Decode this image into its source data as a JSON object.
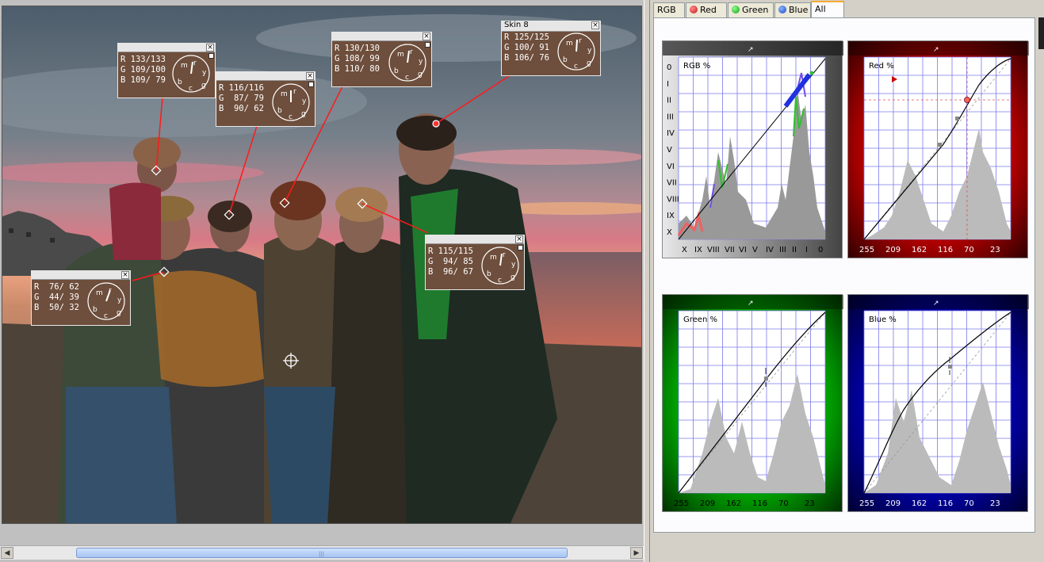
{
  "samples": [
    {
      "id": "s1",
      "title": "",
      "r": "R 133/133",
      "g": "G 109/100",
      "b": "B 109/ 79"
    },
    {
      "id": "s2",
      "title": "",
      "r": "R 116/116",
      "g": "G  87/ 79",
      "b": "B  90/ 62"
    },
    {
      "id": "s3",
      "title": "",
      "r": "R 130/130",
      "g": "G 108/ 99",
      "b": "B 110/ 80"
    },
    {
      "id": "s4",
      "title": "Skin 8",
      "r": "R 125/125",
      "g": "G 100/ 91",
      "b": "B 106/ 76"
    },
    {
      "id": "s5",
      "title": "",
      "r": "R 115/115",
      "g": "G  94/ 85",
      "b": "B  96/ 67"
    },
    {
      "id": "s6",
      "title": "",
      "r": "R  76/ 62",
      "g": "G  44/ 39",
      "b": "B  50/ 32"
    }
  ],
  "dial_letters": {
    "m": "m",
    "r": "r",
    "y": "y",
    "g": "g",
    "c": "c",
    "b": "b"
  },
  "close_glyph": "×",
  "tabs": [
    {
      "label": "RGB",
      "dot": ""
    },
    {
      "label": "Red",
      "dot": "#d42a2a"
    },
    {
      "label": "Green",
      "dot": "#2aa02a"
    },
    {
      "label": "Blue",
      "dot": "#2a5fd4"
    },
    {
      "label": "All",
      "dot": ""
    }
  ],
  "active_tab": "All",
  "panels": {
    "rgb": {
      "label": "RGB %",
      "bg": "#999999",
      "roman_y": [
        "0",
        "I",
        "II",
        "III",
        "IV",
        "V",
        "VI",
        "VII",
        "VIII",
        "IX",
        "X"
      ],
      "roman_x": [
        "X",
        "IX",
        "VIII",
        "VII",
        "VI",
        "V",
        "IV",
        "III",
        "II",
        "I",
        "0"
      ]
    },
    "red": {
      "label": "Red %",
      "bg": "#aa0000",
      "ticks": [
        "255",
        "209",
        "162",
        "116",
        "70",
        "23"
      ]
    },
    "green": {
      "label": "Green %",
      "bg": "#008800",
      "ticks": [
        "255",
        "209",
        "162",
        "116",
        "70",
        "23"
      ]
    },
    "blue": {
      "label": "Blue %",
      "bg": "#000088",
      "ticks": [
        "255",
        "209",
        "162",
        "116",
        "70",
        "23"
      ]
    }
  }
}
